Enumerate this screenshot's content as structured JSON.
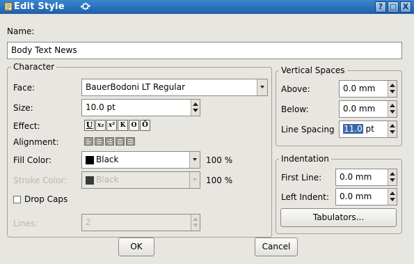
{
  "window": {
    "title": "Edit Style",
    "title_deco": "⛮",
    "controls": {
      "help": "?",
      "maximize": "□",
      "close": "X"
    }
  },
  "name": {
    "label": "Name:",
    "value": "Body Text News"
  },
  "character": {
    "group_label": "Character",
    "face": {
      "label": "Face:",
      "value": "BauerBodoni LT Regular"
    },
    "size": {
      "label": "Size:",
      "value": "10.0 pt"
    },
    "effect": {
      "label": "Effect:",
      "buttons": [
        {
          "name": "underline",
          "glyph": "U"
        },
        {
          "name": "subscript",
          "glyph": "x₂"
        },
        {
          "name": "superscript",
          "glyph": "x²"
        },
        {
          "name": "small-caps",
          "glyph": "K"
        },
        {
          "name": "outline",
          "glyph": "O"
        },
        {
          "name": "all-caps",
          "glyph": "Ō"
        }
      ]
    },
    "alignment": {
      "label": "Alignment:",
      "buttons": [
        "left",
        "center",
        "right",
        "justify",
        "forced"
      ]
    },
    "fill_color": {
      "label": "Fill Color:",
      "value": "Black",
      "shade": "100 %",
      "swatch": "#000000"
    },
    "stroke_color": {
      "label": "Stroke Color:",
      "value": "Black",
      "shade": "100 %",
      "swatch": "#3a3a3a"
    },
    "drop_caps": {
      "label": "Drop Caps",
      "checked": false
    },
    "lines": {
      "label": "Lines:",
      "value": "2"
    }
  },
  "vertical_spaces": {
    "group_label": "Vertical Spaces",
    "above": {
      "label": "Above:",
      "value": "0.0 mm"
    },
    "below": {
      "label": "Below:",
      "value": "0.0 mm"
    },
    "line_spacing": {
      "label": "Line Spacing",
      "value_selected": "11.0",
      "unit": "pt"
    }
  },
  "indentation": {
    "group_label": "Indentation",
    "first_line": {
      "label": "First Line:",
      "value": "0.0 mm"
    },
    "left_indent": {
      "label": "Left Indent:",
      "value": "0.0 mm"
    },
    "tabulators_label": "Tabulators..."
  },
  "buttons": {
    "ok": "OK",
    "cancel": "Cancel"
  }
}
